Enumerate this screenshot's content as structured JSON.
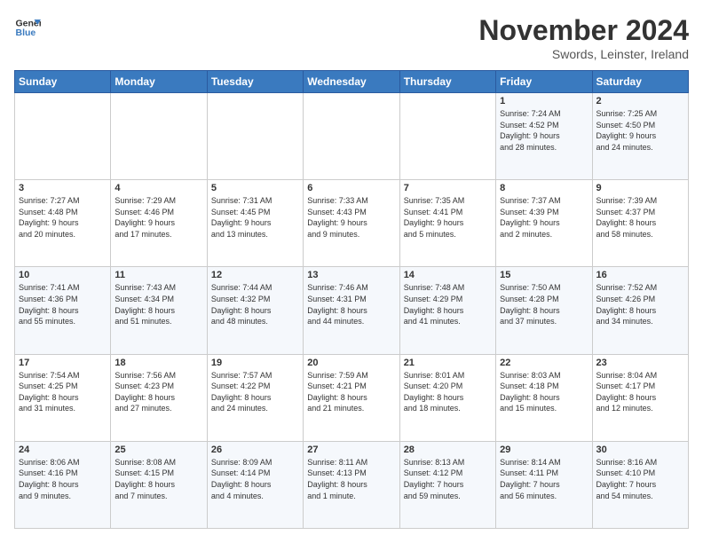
{
  "logo": {
    "line1": "General",
    "line2": "Blue"
  },
  "title": "November 2024",
  "subtitle": "Swords, Leinster, Ireland",
  "weekdays": [
    "Sunday",
    "Monday",
    "Tuesday",
    "Wednesday",
    "Thursday",
    "Friday",
    "Saturday"
  ],
  "weeks": [
    [
      {
        "day": "",
        "info": ""
      },
      {
        "day": "",
        "info": ""
      },
      {
        "day": "",
        "info": ""
      },
      {
        "day": "",
        "info": ""
      },
      {
        "day": "",
        "info": ""
      },
      {
        "day": "1",
        "info": "Sunrise: 7:24 AM\nSunset: 4:52 PM\nDaylight: 9 hours\nand 28 minutes."
      },
      {
        "day": "2",
        "info": "Sunrise: 7:25 AM\nSunset: 4:50 PM\nDaylight: 9 hours\nand 24 minutes."
      }
    ],
    [
      {
        "day": "3",
        "info": "Sunrise: 7:27 AM\nSunset: 4:48 PM\nDaylight: 9 hours\nand 20 minutes."
      },
      {
        "day": "4",
        "info": "Sunrise: 7:29 AM\nSunset: 4:46 PM\nDaylight: 9 hours\nand 17 minutes."
      },
      {
        "day": "5",
        "info": "Sunrise: 7:31 AM\nSunset: 4:45 PM\nDaylight: 9 hours\nand 13 minutes."
      },
      {
        "day": "6",
        "info": "Sunrise: 7:33 AM\nSunset: 4:43 PM\nDaylight: 9 hours\nand 9 minutes."
      },
      {
        "day": "7",
        "info": "Sunrise: 7:35 AM\nSunset: 4:41 PM\nDaylight: 9 hours\nand 5 minutes."
      },
      {
        "day": "8",
        "info": "Sunrise: 7:37 AM\nSunset: 4:39 PM\nDaylight: 9 hours\nand 2 minutes."
      },
      {
        "day": "9",
        "info": "Sunrise: 7:39 AM\nSunset: 4:37 PM\nDaylight: 8 hours\nand 58 minutes."
      }
    ],
    [
      {
        "day": "10",
        "info": "Sunrise: 7:41 AM\nSunset: 4:36 PM\nDaylight: 8 hours\nand 55 minutes."
      },
      {
        "day": "11",
        "info": "Sunrise: 7:43 AM\nSunset: 4:34 PM\nDaylight: 8 hours\nand 51 minutes."
      },
      {
        "day": "12",
        "info": "Sunrise: 7:44 AM\nSunset: 4:32 PM\nDaylight: 8 hours\nand 48 minutes."
      },
      {
        "day": "13",
        "info": "Sunrise: 7:46 AM\nSunset: 4:31 PM\nDaylight: 8 hours\nand 44 minutes."
      },
      {
        "day": "14",
        "info": "Sunrise: 7:48 AM\nSunset: 4:29 PM\nDaylight: 8 hours\nand 41 minutes."
      },
      {
        "day": "15",
        "info": "Sunrise: 7:50 AM\nSunset: 4:28 PM\nDaylight: 8 hours\nand 37 minutes."
      },
      {
        "day": "16",
        "info": "Sunrise: 7:52 AM\nSunset: 4:26 PM\nDaylight: 8 hours\nand 34 minutes."
      }
    ],
    [
      {
        "day": "17",
        "info": "Sunrise: 7:54 AM\nSunset: 4:25 PM\nDaylight: 8 hours\nand 31 minutes."
      },
      {
        "day": "18",
        "info": "Sunrise: 7:56 AM\nSunset: 4:23 PM\nDaylight: 8 hours\nand 27 minutes."
      },
      {
        "day": "19",
        "info": "Sunrise: 7:57 AM\nSunset: 4:22 PM\nDaylight: 8 hours\nand 24 minutes."
      },
      {
        "day": "20",
        "info": "Sunrise: 7:59 AM\nSunset: 4:21 PM\nDaylight: 8 hours\nand 21 minutes."
      },
      {
        "day": "21",
        "info": "Sunrise: 8:01 AM\nSunset: 4:20 PM\nDaylight: 8 hours\nand 18 minutes."
      },
      {
        "day": "22",
        "info": "Sunrise: 8:03 AM\nSunset: 4:18 PM\nDaylight: 8 hours\nand 15 minutes."
      },
      {
        "day": "23",
        "info": "Sunrise: 8:04 AM\nSunset: 4:17 PM\nDaylight: 8 hours\nand 12 minutes."
      }
    ],
    [
      {
        "day": "24",
        "info": "Sunrise: 8:06 AM\nSunset: 4:16 PM\nDaylight: 8 hours\nand 9 minutes."
      },
      {
        "day": "25",
        "info": "Sunrise: 8:08 AM\nSunset: 4:15 PM\nDaylight: 8 hours\nand 7 minutes."
      },
      {
        "day": "26",
        "info": "Sunrise: 8:09 AM\nSunset: 4:14 PM\nDaylight: 8 hours\nand 4 minutes."
      },
      {
        "day": "27",
        "info": "Sunrise: 8:11 AM\nSunset: 4:13 PM\nDaylight: 8 hours\nand 1 minute."
      },
      {
        "day": "28",
        "info": "Sunrise: 8:13 AM\nSunset: 4:12 PM\nDaylight: 7 hours\nand 59 minutes."
      },
      {
        "day": "29",
        "info": "Sunrise: 8:14 AM\nSunset: 4:11 PM\nDaylight: 7 hours\nand 56 minutes."
      },
      {
        "day": "30",
        "info": "Sunrise: 8:16 AM\nSunset: 4:10 PM\nDaylight: 7 hours\nand 54 minutes."
      }
    ]
  ]
}
